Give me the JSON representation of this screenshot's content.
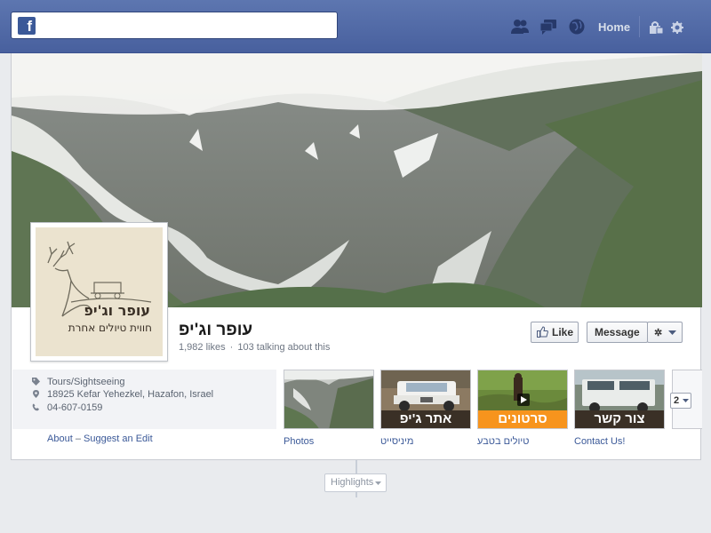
{
  "topbar": {
    "logo": "f",
    "search_placeholder": "",
    "home_label": "Home"
  },
  "page": {
    "name": "עופר וג'יפ",
    "likes": "1,982 likes",
    "talking": "103 talking about this",
    "profile_text_title": "עופר וג'יפ",
    "profile_text_sub": "חווית טיולים אחרת"
  },
  "actions": {
    "like_label": "Like",
    "message_label": "Message",
    "gear_label": "✲"
  },
  "about": {
    "category": "Tours/Sightseeing",
    "address": "18925 Kefar Yehezkel, Hazafon, Israel",
    "phone": "04-607-0159",
    "about_link": "About",
    "separator": "–",
    "suggest_link": "Suggest an Edit"
  },
  "apps": [
    {
      "label": "Photos",
      "banner": ""
    },
    {
      "label": "מיניסייט",
      "banner": "אתר ג'יפ"
    },
    {
      "label": "טיולים בטבע",
      "banner": "סרטונים"
    },
    {
      "label": "Contact Us!",
      "banner": "צור קשר"
    }
  ],
  "more_count": "2",
  "timeline": {
    "highlights_label": "Highlights"
  },
  "colors": {
    "brand": "#3b5998",
    "orange_banner": "#f7941d",
    "dark_banner": "#3a3026"
  }
}
